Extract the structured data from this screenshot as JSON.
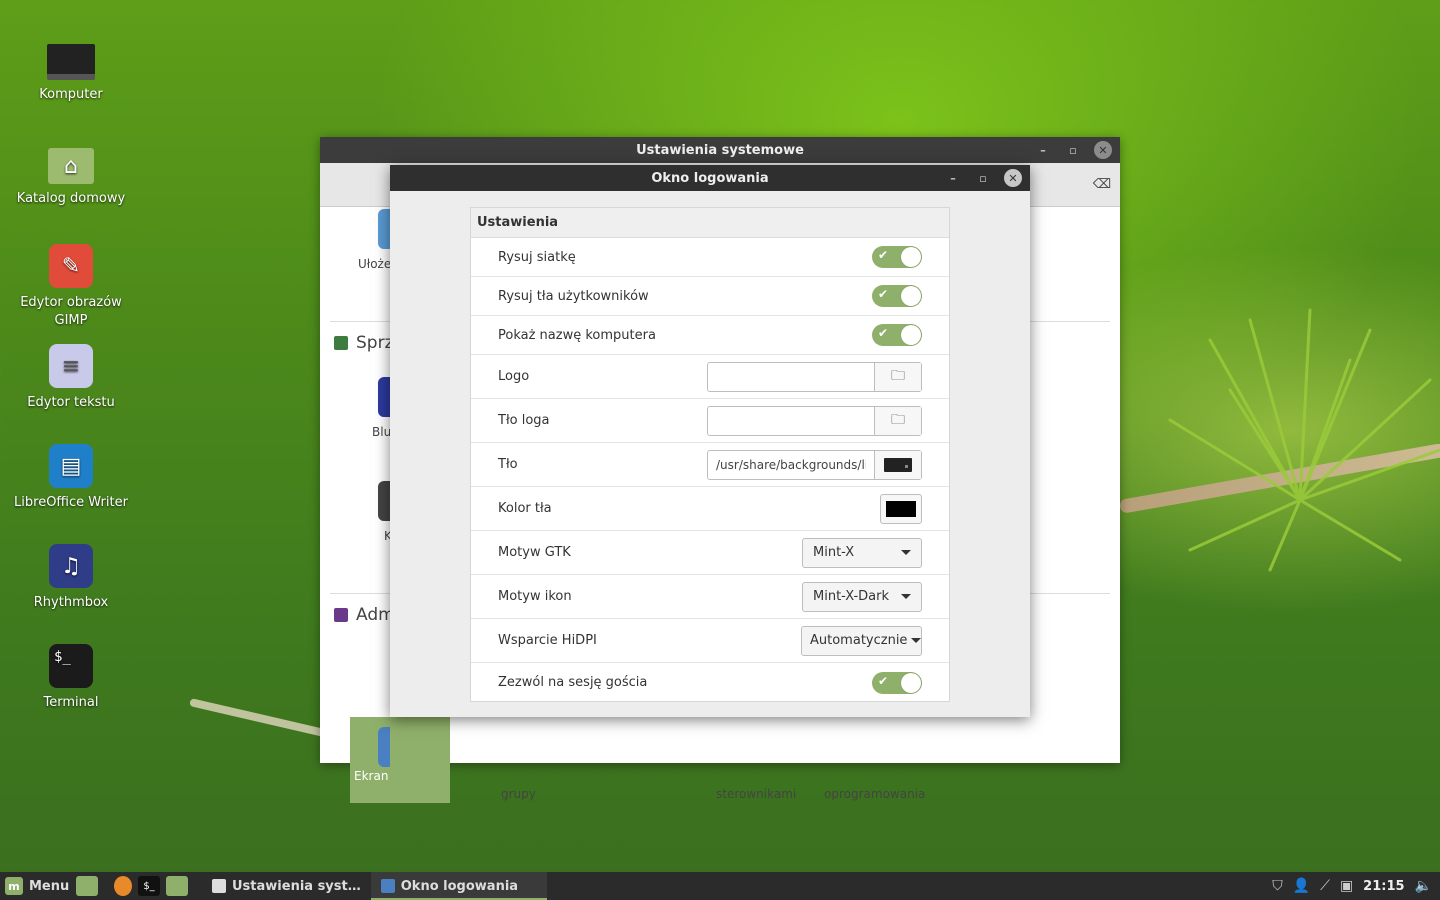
{
  "desktop": {
    "icons": [
      {
        "label": "Komputer",
        "icon": "computer-icon"
      },
      {
        "label": "Katalog domowy",
        "icon": "home-folder-icon"
      },
      {
        "label": "Edytor obrazów GIMP",
        "icon": "gimp-icon"
      },
      {
        "label": "Edytor tekstu",
        "icon": "text-editor-icon"
      },
      {
        "label": "LibreOffice Writer",
        "icon": "writer-icon"
      },
      {
        "label": "Rhythmbox",
        "icon": "rhythmbox-icon"
      },
      {
        "label": "Terminal",
        "icon": "terminal-icon"
      }
    ]
  },
  "back_window": {
    "title": "Ustawienia systemowe",
    "sections": {
      "hardware": "Sprz",
      "admin": "Adm"
    },
    "items": {
      "layout_partial": "Ułoże",
      "bluetooth_partial": "Blu",
      "k_partial": "K",
      "ekran_partial": "Ekran",
      "grupy": "grupy",
      "sterownikami": "sterownikami",
      "oprogramowania": "oprogramowania"
    }
  },
  "login_window": {
    "title": "Okno logowania",
    "section_header": "Ustawienia",
    "rows": {
      "draw_grid": {
        "label": "Rysuj siatkę",
        "enabled": true
      },
      "draw_user_bg": {
        "label": "Rysuj tła użytkowników",
        "enabled": true
      },
      "show_hostname": {
        "label": "Pokaż nazwę komputera",
        "enabled": true
      },
      "logo": {
        "label": "Logo",
        "value": ""
      },
      "logo_bg": {
        "label": "Tło loga",
        "value": ""
      },
      "background": {
        "label": "Tło",
        "value": "/usr/share/backgrounds/lin"
      },
      "bg_color": {
        "label": "Kolor tła",
        "color": "#000000"
      },
      "gtk_theme": {
        "label": "Motyw GTK",
        "value": "Mint-X"
      },
      "icon_theme": {
        "label": "Motyw ikon",
        "value": "Mint-X-Dark"
      },
      "hidpi": {
        "label": "Wsparcie HiDPI",
        "value": "Automatycznie"
      },
      "guest": {
        "label": "Zezwól na sesję gościa",
        "enabled": true
      }
    }
  },
  "taskbar": {
    "menu_label": "Menu",
    "tasks": [
      {
        "label": "Ustawienia syst…",
        "active": false
      },
      {
        "label": "Okno logowania",
        "active": true
      }
    ],
    "clock": "21:15"
  },
  "colors": {
    "accent": "#8fb06a",
    "titlebar": "#2f2f2f"
  }
}
